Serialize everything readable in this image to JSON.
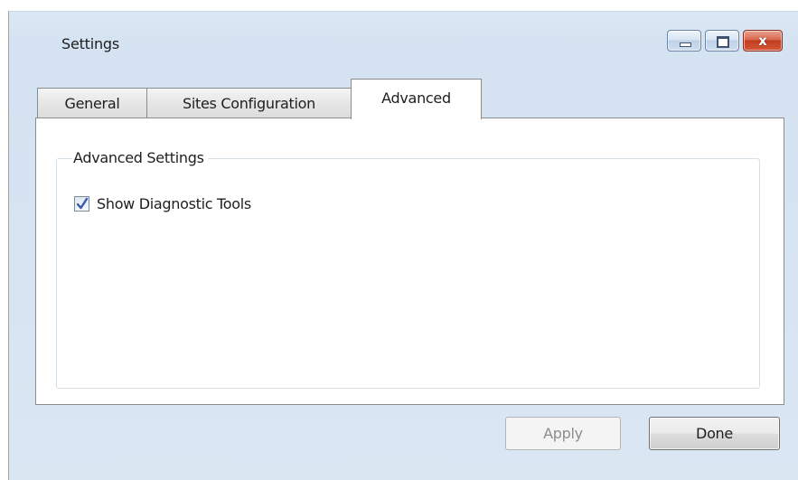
{
  "window": {
    "title": "Settings",
    "caption_buttons": {
      "minimize_icon": "minimize-icon",
      "maximize_icon": "maximize-icon",
      "close_glyph": "x"
    }
  },
  "tabs": [
    {
      "label": "General",
      "selected": false
    },
    {
      "label": "Sites Configuration",
      "selected": false
    },
    {
      "label": "Advanced",
      "selected": true
    }
  ],
  "advanced": {
    "group_title": "Advanced Settings",
    "show_diagnostic_tools": {
      "label": "Show Diagnostic Tools",
      "checked": true
    }
  },
  "footer": {
    "apply_label": "Apply",
    "apply_enabled": false,
    "done_label": "Done"
  },
  "colors": {
    "window_frame": "#d4e2f1",
    "close_button": "#c13b20",
    "checkmark": "#3a5aa8"
  }
}
